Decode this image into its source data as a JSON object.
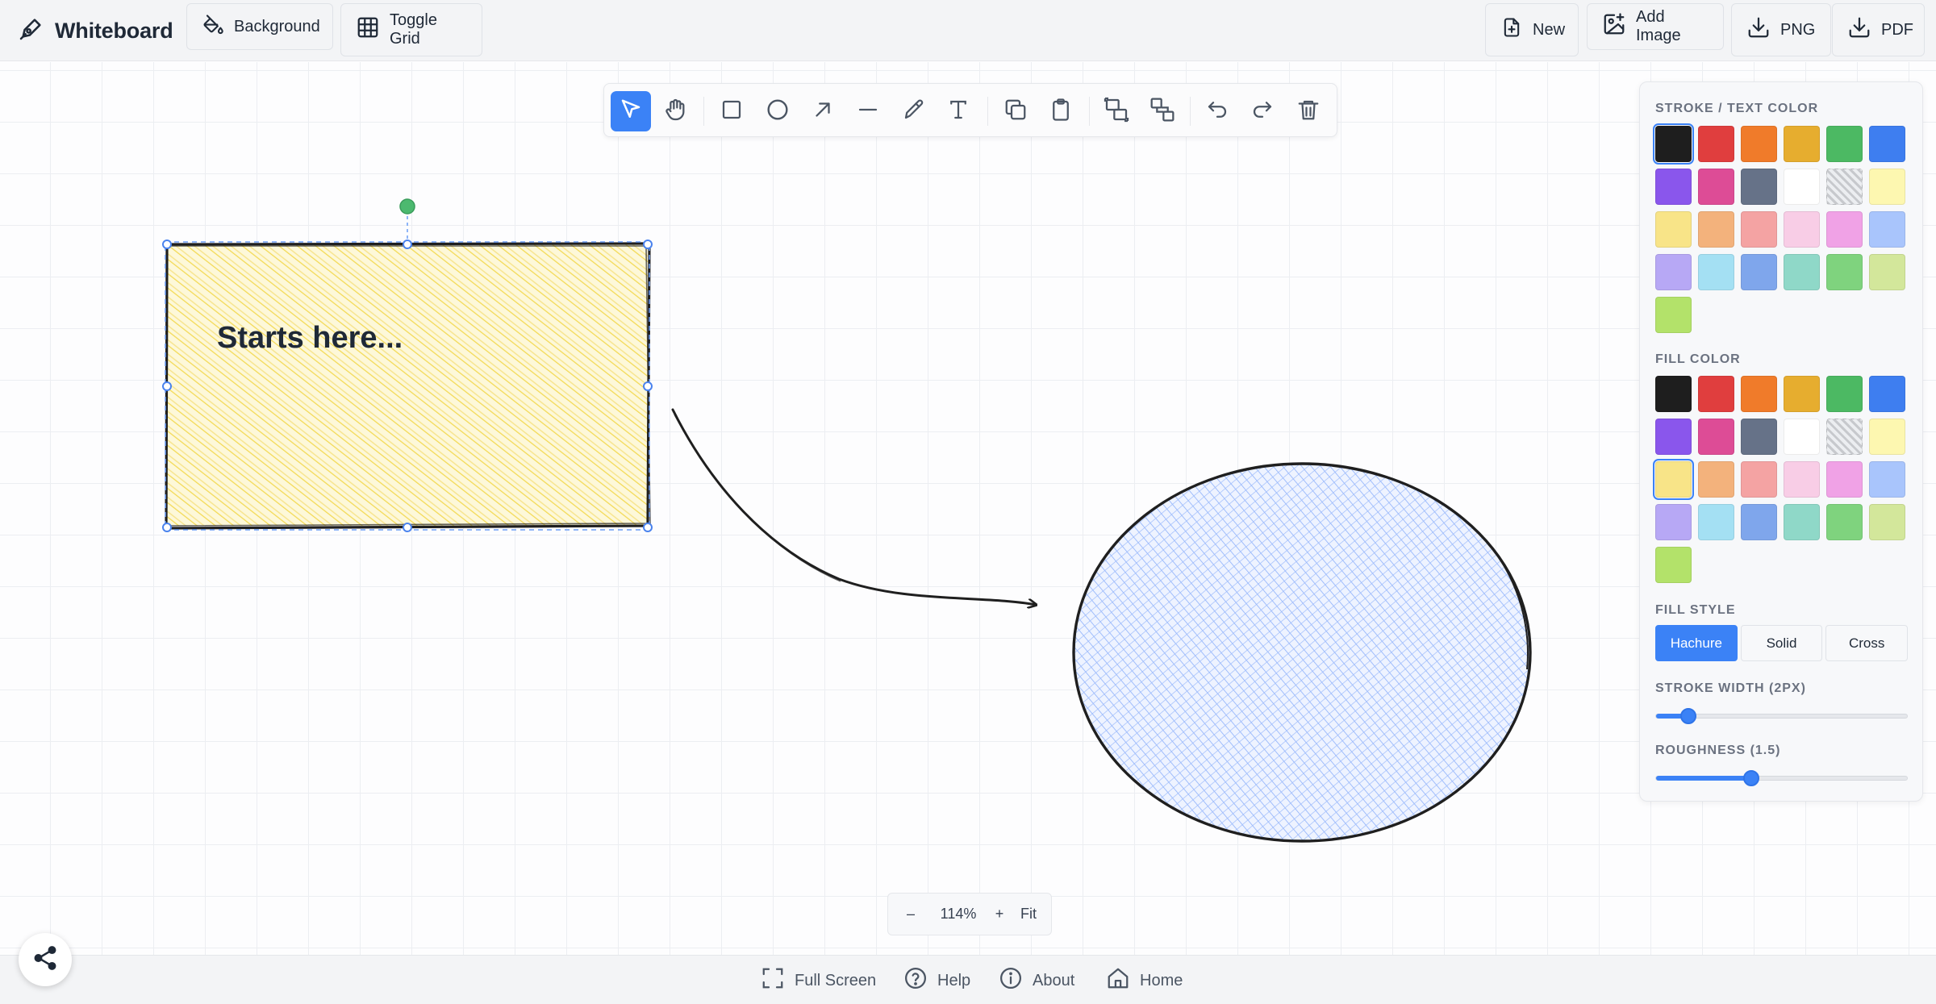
{
  "app": {
    "title": "Whiteboard"
  },
  "header": {
    "background_label": "Background",
    "grid_label": "Toggle Grid",
    "new_label": "New",
    "add_image_label": "Add Image",
    "png_label": "PNG",
    "pdf_label": "PDF"
  },
  "toolbar": {
    "tools": [
      "select-icon",
      "hand-icon",
      "rectangle-icon",
      "ellipse-icon",
      "arrow-icon",
      "line-icon",
      "pencil-icon",
      "text-icon",
      "copy-icon",
      "paste-icon",
      "group-icon",
      "ungroup-icon",
      "undo-icon",
      "redo-icon",
      "trash-icon"
    ],
    "active_tool": "select-icon"
  },
  "canvas": {
    "note_text": "Starts here...",
    "note_fill": "#f8e06a",
    "ellipse_fill": "#93b5ff"
  },
  "panel": {
    "stroke_label": "STROKE / TEXT COLOR",
    "fill_label": "FILL COLOR",
    "fill_style_label": "FILL STYLE",
    "stroke_width_label": "STROKE WIDTH (2PX)",
    "roughness_label": "ROUGHNESS (1.5)",
    "fill_styles": [
      "Hachure",
      "Solid",
      "Cross"
    ],
    "active_fill_style": "Hachure",
    "palette": [
      "#1e1e1e",
      "#e03e3e",
      "#f07b2a",
      "#e6ad2f",
      "#4cb963",
      "#3e7ef0",
      "#8a56ec",
      "#dd4c96",
      "#667288",
      "#ffffff",
      "transparent",
      "#fdf7b0",
      "#f8e488",
      "#f3b27c",
      "#f4a3a3",
      "#f8cde6",
      "#f0a2e6",
      "#a9c5fc",
      "#b7a8f5",
      "#a4e0f3",
      "#7fa6ec",
      "#8fd8c8",
      "#7fd37e",
      "#d3e79b",
      "#b3e26a"
    ],
    "selected_stroke": "#1e1e1e",
    "selected_fill": "#f8e488",
    "stroke_width_fraction": 0.13,
    "roughness_fraction": 0.38
  },
  "zoom": {
    "minus": "–",
    "level": "114%",
    "plus": "+",
    "fit": "Fit"
  },
  "footer": {
    "fullscreen_label": "Full Screen",
    "help_label": "Help",
    "about_label": "About",
    "home_label": "Home"
  }
}
